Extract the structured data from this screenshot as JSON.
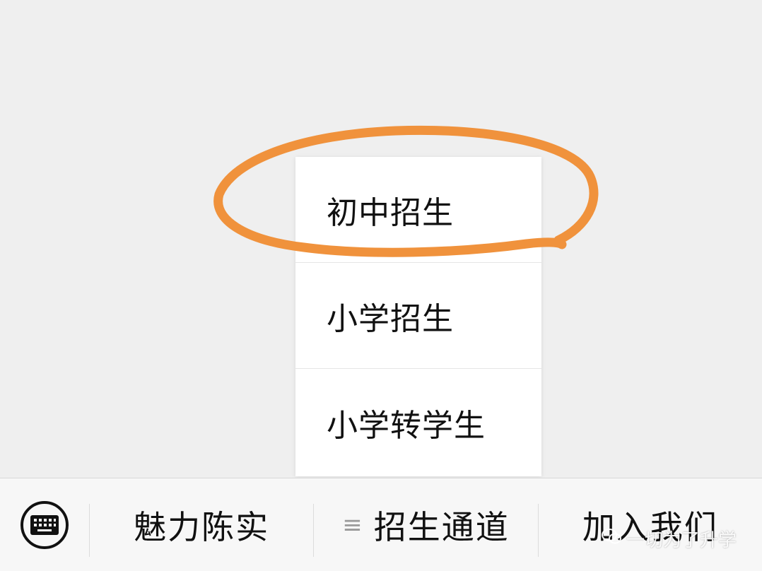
{
  "popup_menu": {
    "items": [
      {
        "label": "初中招生"
      },
      {
        "label": "小学招生"
      },
      {
        "label": "小学转学生"
      }
    ]
  },
  "menu_bar": {
    "keyboard_icon": "keyboard-icon",
    "buttons": [
      {
        "label": "魅力陈实"
      },
      {
        "label": "招生通道",
        "icon": "list-icon"
      },
      {
        "label": "加入我们"
      }
    ]
  },
  "watermark": {
    "text": "一切为了升学"
  },
  "colors": {
    "annotation": "#f0923c",
    "background": "#efefef",
    "menu_bar": "#f7f7f7",
    "popup": "#ffffff"
  }
}
